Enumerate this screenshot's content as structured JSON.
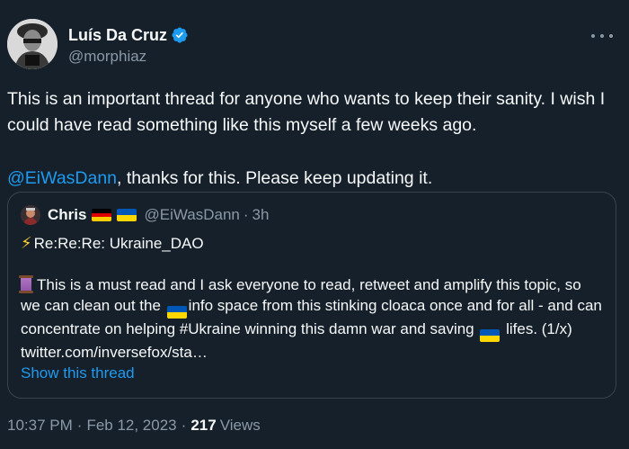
{
  "author": {
    "display_name": "Luís Da Cruz",
    "handle": "@morphiaz",
    "verified": true
  },
  "tweet": {
    "paragraph1": "This is an important thread for anyone who wants to keep their sanity. I wish I could have read something like this myself a few weeks ago.",
    "mention": "@EiWasDann",
    "paragraph2_rest": ", thanks for this. Please keep updating it."
  },
  "quote": {
    "name": "Chris",
    "handle": "@EiWasDann",
    "separator": "·",
    "time": "3h",
    "title": "Re:Re:Re: Ukraine_DAO",
    "body_part1": "This is a must read and I ask everyone to read, retweet and amplify this topic, so we can clean out the ",
    "body_part2": "info space from this stinking cloaca once and for all - and can concentrate on helping #Ukraine winning this damn war and saving ",
    "body_part3": " lifes. (1/x) twitter.com/inversefox/sta…",
    "show_thread": "Show this thread"
  },
  "footer": {
    "time": "10:37 PM",
    "sep1": "·",
    "date": "Feb 12, 2023",
    "sep2": "·",
    "views_count": "217",
    "views_label": "Views"
  },
  "colors": {
    "background": "#15202b",
    "accent": "#1d9bf0",
    "text": "#f7f9f9",
    "muted": "#8b98a5",
    "border": "#38444d"
  },
  "icons": [
    "verified-badge-icon",
    "more-options-icon",
    "high-voltage-icon",
    "thread-icon",
    "germany-flag-icon",
    "ukraine-flag-icon"
  ]
}
